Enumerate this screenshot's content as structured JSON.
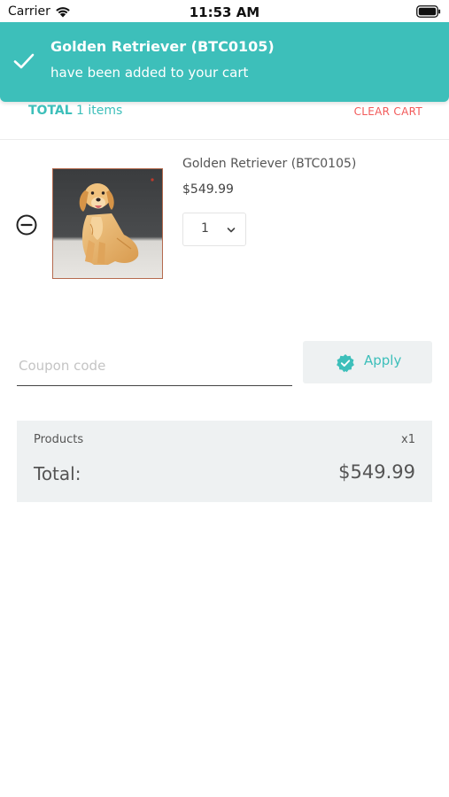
{
  "status_bar": {
    "carrier": "Carrier",
    "time": "11:53 AM",
    "icons": [
      "wifi-icon",
      "battery-icon"
    ]
  },
  "toast": {
    "title": "Golden Retriever (BTC0105)",
    "message": "have been added to your cart",
    "icon": "checkmark-icon",
    "color": "#3dbfba"
  },
  "cart_header": {
    "total_label": "TOTAL",
    "item_count": "1 items",
    "clear_label": "CLEAR CART"
  },
  "cart_items": [
    {
      "name": "Golden Retriever (BTC0105)",
      "price": "$549.99",
      "quantity": "1",
      "image": "golden-retriever-figurine"
    }
  ],
  "coupon": {
    "placeholder": "Coupon code",
    "value": "",
    "apply_label": "Apply"
  },
  "summary": {
    "products_label": "Products",
    "products_count": "x1",
    "total_label": "Total:",
    "total_value": "$549.99"
  },
  "colors": {
    "accent": "#3dbfba",
    "danger": "#f25a5a",
    "panel": "#eef1f2"
  }
}
